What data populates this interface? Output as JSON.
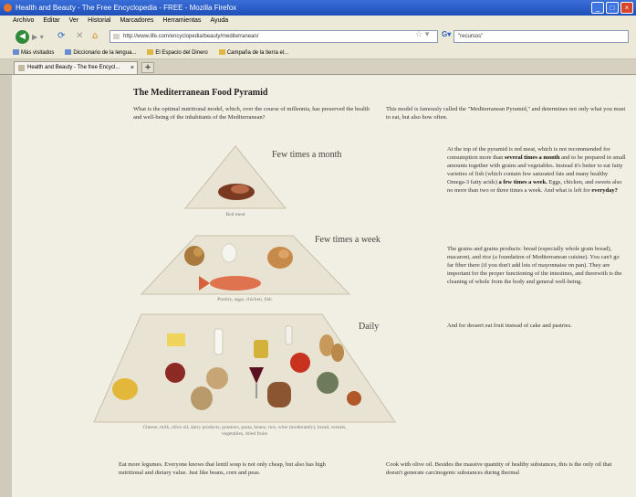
{
  "window": {
    "title": "Health and Beauty - The Free Encyclopedia - FREE - Mozilla Firefox"
  },
  "menu": [
    "Archivo",
    "Editar",
    "Ver",
    "Historial",
    "Marcadores",
    "Herramientas",
    "Ayuda"
  ],
  "navigation": {
    "url": "http://www.life.com/encyclopedia/beauty/mediterranean/",
    "search_value": "\"recursos\""
  },
  "bookmarks": [
    "Más visitados",
    "Diccionario de la lengua...",
    "El Espacio del Dinero",
    "Campaña de la tierra el..."
  ],
  "tab": {
    "label": "Health and Beauty - The free Encycl..."
  },
  "page": {
    "title": "The Mediterranean Food Pyramid",
    "intro_left": "What is the optimal nutritional model, which, over the course of millennia, has preserved the health and well-being of the inhabitants of the Mediterranean?",
    "intro_right": "This model is famously called the \"Mediterranean Pyramid,\" and determines not only what you must to eat, but also how often.",
    "levels": [
      {
        "label": "Few times a month",
        "caption": "Red meat"
      },
      {
        "label": "Few times a week",
        "caption": "Poultry, eggs, chicken, fish"
      },
      {
        "label": "Daily",
        "caption": "Cheese, milk, olive oil, dairy products, potatoes, pasta, beans, rice, wine (moderately), bread, cereals, vegetables, dried fruits"
      }
    ],
    "side_text": {
      "p1_a": "At the top of the pyramid is red meat, which is not recommended for consumption more than",
      "p1_b1": "several times a month",
      "p1_c": "and to be prepared in small amounts together with grains and vegetables. Instead it's better to eat fatty varieties of fish (which contain few saturated fats and many healthy Omega-3 fatty acids)",
      "p1_b2": "a few times a week.",
      "p1_d": "Eggs, chicken, and sweets also no more than two or three times a week. And what is left for",
      "p1_b3": "everyday?",
      "p2": "The grains and grains products: bread (especially whole grain bread), macaroni, and rice (a foundation of Mediterranean cuisine). You can't go far fiber there (if you don't add lots of mayonnaise on pan). They are important for the proper functioning of the intestines, and therewith is the cleaning of whole from the body and general well-being.",
      "p3": "And for dessert eat fruit instead of cake and pastries."
    },
    "bottom_left": "Eat more legumes. Everyone knows that lentil soup is not only cheap, but also has high nutritional and dietary value. Just like beans, corn and peas.",
    "bottom_right": "Cook with olive oil. Besides the massive quantity of healthy substances, this is the only oil that doesn't generate carcinogenic substances during thermal"
  }
}
